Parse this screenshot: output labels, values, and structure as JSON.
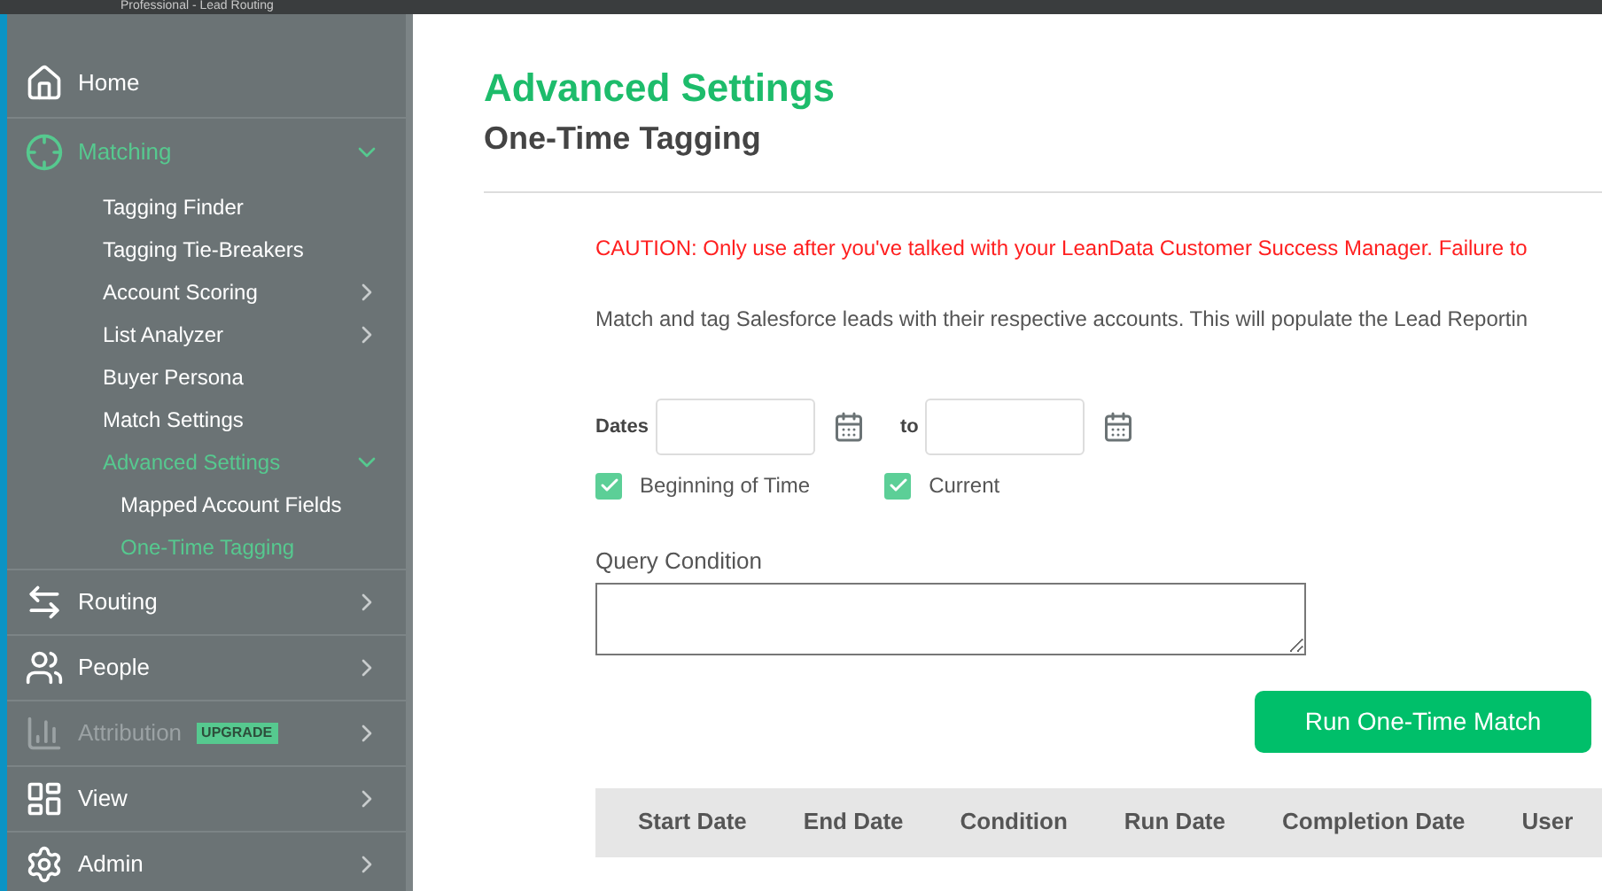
{
  "top_bar": {
    "text": "Professional - Lead Routing"
  },
  "sidebar": {
    "items": [
      {
        "label": "Home",
        "kind": "home",
        "disabled": false
      },
      {
        "label": "Matching",
        "kind": "matching",
        "expanded": true,
        "disabled": false,
        "selected": true,
        "children": [
          {
            "label": "Tagging Finder",
            "selected": false
          },
          {
            "label": "Tagging Tie-Breakers",
            "selected": false
          },
          {
            "label": "Account Scoring",
            "selected": false,
            "expanded": false
          },
          {
            "label": "List Analyzer",
            "selected": false,
            "expanded": false
          },
          {
            "label": "Buyer Persona",
            "selected": false
          },
          {
            "label": "Match Settings",
            "selected": false
          },
          {
            "label": "Advanced Settings",
            "selected": true,
            "expanded": true,
            "children": [
              {
                "label": "Mapped Account Fields",
                "selected": false
              },
              {
                "label": "One-Time Tagging",
                "selected": true
              }
            ]
          }
        ]
      },
      {
        "label": "Routing",
        "kind": "routing",
        "expanded": false,
        "disabled": false
      },
      {
        "label": "People",
        "kind": "people",
        "expanded": false,
        "disabled": false
      },
      {
        "label": "Attribution",
        "kind": "attribution",
        "expanded": false,
        "disabled": true,
        "badge": "UPGRADE"
      },
      {
        "label": "View",
        "kind": "view",
        "expanded": false,
        "disabled": false
      },
      {
        "label": "Admin",
        "kind": "admin",
        "expanded": false,
        "disabled": false
      }
    ]
  },
  "page": {
    "title": "Advanced Settings",
    "subtitle": "One-Time Tagging",
    "caution": "CAUTION: Only use after you've talked with your LeanData Customer Success Manager. Failure to",
    "description": "Match and tag Salesforce leads with their respective accounts. This will populate the Lead Reportin",
    "dates_label": "Dates",
    "to_label": "to",
    "checkboxes": [
      {
        "label": "Beginning of Time",
        "checked": true
      },
      {
        "label": "Current",
        "checked": true
      }
    ],
    "query_label": "Query Condition",
    "run_button": "Run One-Time Match"
  },
  "table": {
    "columns": [
      "Start Date",
      "End Date",
      "Condition",
      "Run Date",
      "Completion Date",
      "User"
    ]
  }
}
